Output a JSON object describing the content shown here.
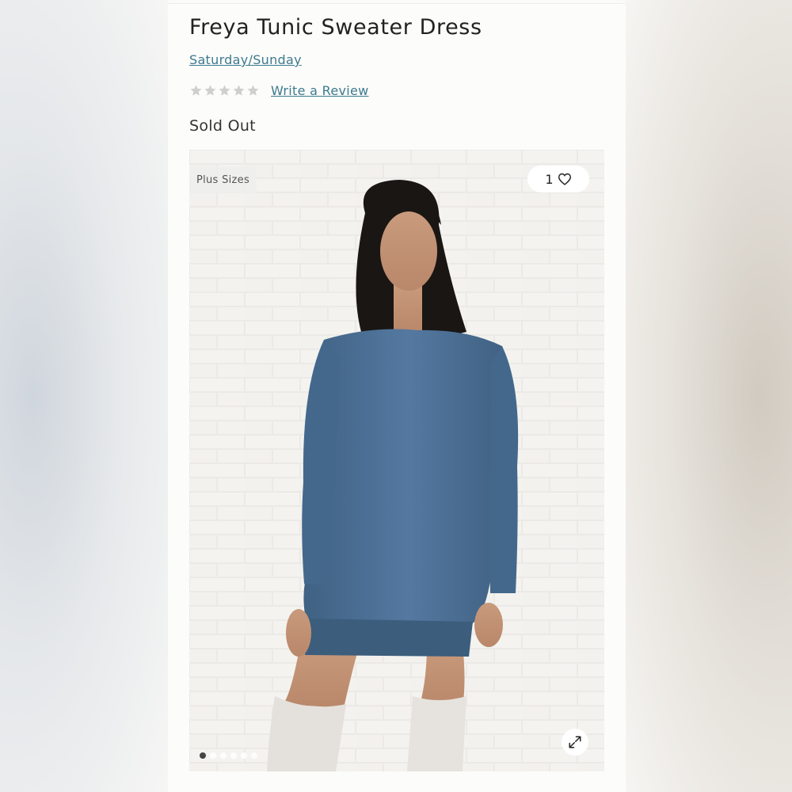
{
  "product": {
    "title": "Freya Tunic Sweater Dress",
    "brand": "Saturday/Sunday",
    "rating": 0,
    "rating_max": 5,
    "review_link": "Write a Review",
    "status": "Sold Out"
  },
  "image": {
    "badge": "Plus Sizes",
    "like_count": "1",
    "dots_total": 6,
    "dot_active": 1,
    "icons": {
      "like": "heart-icon",
      "expand": "expand-arrows-icon",
      "star": "star-icon"
    }
  },
  "colors": {
    "link": "#3d7a8f",
    "text": "#222222",
    "sweater": "#4d6f92",
    "star_empty": "#cfcfcf"
  }
}
